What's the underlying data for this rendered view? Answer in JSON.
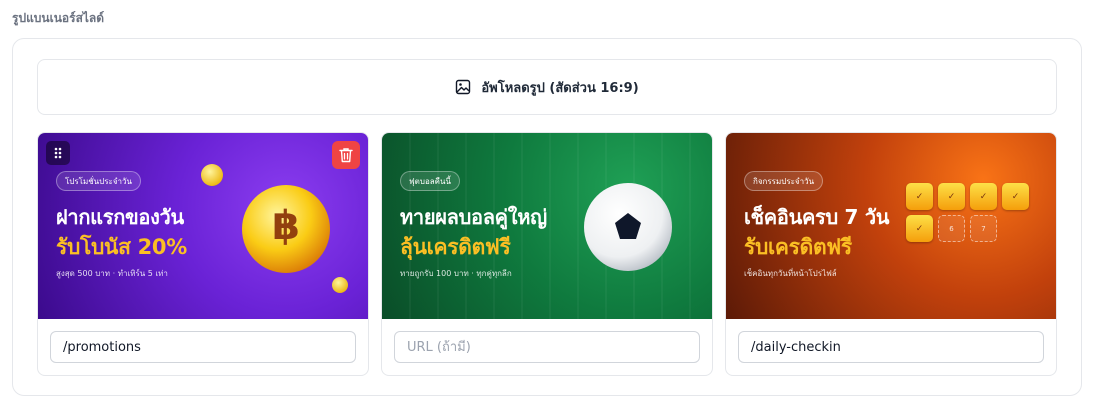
{
  "section": {
    "label": "รูปแบนเนอร์สไลด์"
  },
  "upload": {
    "label": "อัพโหลดรูป (สัดส่วน 16:9)",
    "icon": "image-icon"
  },
  "banners": [
    {
      "tag": "โปรโมชั่นประจำวัน",
      "headline": "ฝากแรกของวัน",
      "highlight": "รับโบนัส 20%",
      "sub": "สูงสุด 500 บาท · ทำเทิร์น 5 เท่า",
      "coin_symbol": "฿",
      "url_value": "/promotions",
      "url_placeholder": "URL (ถ้ามี)",
      "colors": {
        "bg_from": "#7c2fe0",
        "bg_to": "#3b0a8c"
      }
    },
    {
      "tag": "ฟุตบอลคืนนี้",
      "headline": "ทายผลบอลคู่ใหญ่",
      "highlight": "ลุ้นเครดิตฟรี",
      "sub": "ทายถูกรับ 100 บาท · ทุกคู่ทุกลีก",
      "url_value": "",
      "url_placeholder": "URL (ถ้ามี)",
      "colors": {
        "bg_from": "#0f7a3e",
        "bg_to": "#0a4d28"
      }
    },
    {
      "tag": "กิจกรรมประจำวัน",
      "headline": "เช็คอินครบ 7 วัน",
      "highlight": "รับเครดิตฟรี",
      "sub": "เช็คอินทุกวันที่หน้าโปรไฟล์",
      "checkins": [
        "✓",
        "✓",
        "✓",
        "✓",
        "✓",
        "6",
        "7"
      ],
      "url_value": "/daily-checkin",
      "url_placeholder": "URL (ถ้ามี)",
      "colors": {
        "bg_from": "#ea580c",
        "bg_to": "#5c1a07"
      }
    }
  ],
  "icons": {
    "drag": "drag-handle-icon",
    "delete": "trash-icon"
  },
  "colors": {
    "delete": "#ef4444",
    "highlight": "#fbbf24"
  }
}
